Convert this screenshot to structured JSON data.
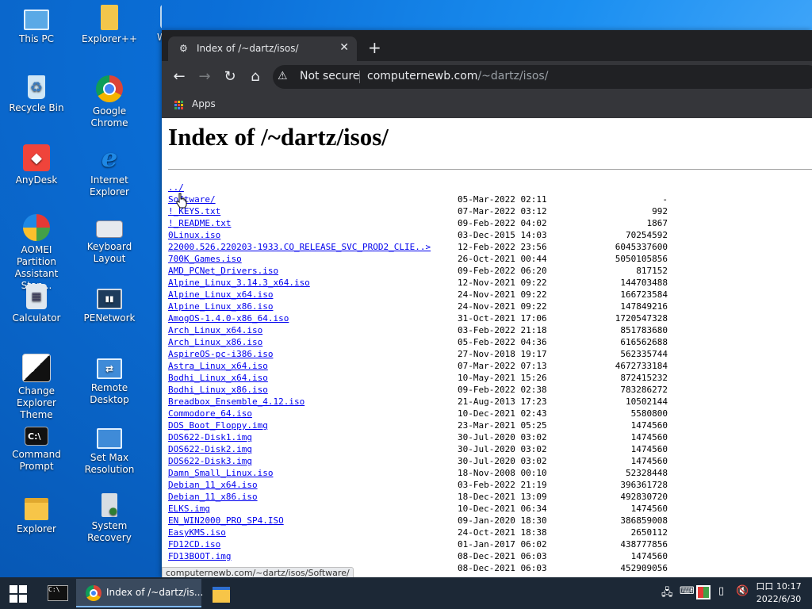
{
  "desktop": {
    "icons": [
      {
        "label": "This PC"
      },
      {
        "label": "Explorer++"
      },
      {
        "label": "W"
      },
      {
        "label": "Recycle Bin"
      },
      {
        "label": "Google Chrome"
      },
      {
        "label": "AnyDesk"
      },
      {
        "label": "Internet Explorer"
      },
      {
        "label": "AOMEI Partition Assistant Stan..."
      },
      {
        "label": "Keyboard Layout"
      },
      {
        "label": "Calculator"
      },
      {
        "label": "PENetwork"
      },
      {
        "label": "Change Explorer Theme"
      },
      {
        "label": "Remote Desktop"
      },
      {
        "label": "Command Prompt"
      },
      {
        "label": "Set Max Resolution"
      },
      {
        "label": "Explorer"
      },
      {
        "label": "System Recovery"
      }
    ]
  },
  "browser": {
    "tab_title": "Index of /~dartz/isos/",
    "new_tab": "+",
    "close_tab": "✕",
    "security_label": "Not secure",
    "url_host": "computernewb.com",
    "url_path": "/~dartz/isos/",
    "bookmarks_apps": "Apps",
    "status_url": "computernewb.com/~dartz/isos/Software/"
  },
  "page": {
    "heading": "Index of /~dartz/isos/",
    "entries": [
      {
        "name": "../",
        "date": "",
        "size": ""
      },
      {
        "name": "Software/",
        "date": "05-Mar-2022 02:11",
        "size": "-"
      },
      {
        "name": "!_KEYS.txt",
        "date": "07-Mar-2022 03:12",
        "size": "992"
      },
      {
        "name": "!_README.txt",
        "date": "09-Feb-2022 04:02",
        "size": "1867"
      },
      {
        "name": "0Linux.iso",
        "date": "03-Dec-2015 14:03",
        "size": "70254592"
      },
      {
        "name": "22000.526.220203-1933.CO_RELEASE_SVC_PROD2_CLIE..>",
        "date": "12-Feb-2022 23:56",
        "size": "6045337600"
      },
      {
        "name": "700K_Games.iso",
        "date": "26-Oct-2021 00:44",
        "size": "5050105856"
      },
      {
        "name": "AMD_PCNet_Drivers.iso",
        "date": "09-Feb-2022 06:20",
        "size": "817152"
      },
      {
        "name": "Alpine_Linux_3.14.3_x64.iso",
        "date": "12-Nov-2021 09:22",
        "size": "144703488"
      },
      {
        "name": "Alpine_Linux_x64.iso",
        "date": "24-Nov-2021 09:22",
        "size": "166723584"
      },
      {
        "name": "Alpine_Linux_x86.iso",
        "date": "24-Nov-2021 09:22",
        "size": "147849216"
      },
      {
        "name": "AmogOS-1.4.0-x86_64.iso",
        "date": "31-Oct-2021 17:06",
        "size": "1720547328"
      },
      {
        "name": "Arch_Linux_x64.iso",
        "date": "03-Feb-2022 21:18",
        "size": "851783680"
      },
      {
        "name": "Arch_Linux_x86.iso",
        "date": "05-Feb-2022 04:36",
        "size": "616562688"
      },
      {
        "name": "AspireOS-pc-i386.iso",
        "date": "27-Nov-2018 19:17",
        "size": "562335744"
      },
      {
        "name": "Astra_Linux_x64.iso",
        "date": "07-Mar-2022 07:13",
        "size": "4672733184"
      },
      {
        "name": "Bodhi_Linux_x64.iso",
        "date": "10-May-2021 15:26",
        "size": "872415232"
      },
      {
        "name": "Bodhi_Linux_x86.iso",
        "date": "09-Feb-2022 02:38",
        "size": "783286272"
      },
      {
        "name": "Breadbox_Ensemble_4.12.iso",
        "date": "21-Aug-2013 17:23",
        "size": "10502144"
      },
      {
        "name": "Commodore_64.iso",
        "date": "10-Dec-2021 02:43",
        "size": "5580800"
      },
      {
        "name": "DOS_Boot_Floppy.img",
        "date": "23-Mar-2021 05:25",
        "size": "1474560"
      },
      {
        "name": "DOS622-Disk1.img",
        "date": "30-Jul-2020 03:02",
        "size": "1474560"
      },
      {
        "name": "DOS622-Disk2.img",
        "date": "30-Jul-2020 03:02",
        "size": "1474560"
      },
      {
        "name": "DOS622-Disk3.img",
        "date": "30-Jul-2020 03:02",
        "size": "1474560"
      },
      {
        "name": "Damn_Small_Linux.iso",
        "date": "18-Nov-2008 00:10",
        "size": "52328448"
      },
      {
        "name": "Debian_11_x64.iso",
        "date": "03-Feb-2022 21:19",
        "size": "396361728"
      },
      {
        "name": "Debian_11_x86.iso",
        "date": "18-Dec-2021 13:09",
        "size": "492830720"
      },
      {
        "name": "ELKS.img",
        "date": "10-Dec-2021 06:34",
        "size": "1474560"
      },
      {
        "name": "EN_WIN2000_PRO_SP4.ISO",
        "date": "09-Jan-2020 18:30",
        "size": "386859008"
      },
      {
        "name": "EasyKMS.iso",
        "date": "24-Oct-2021 18:38",
        "size": "2650112"
      },
      {
        "name": "FD12CD.iso",
        "date": "01-Jan-2017 06:02",
        "size": "438777856"
      },
      {
        "name": "FD13BOOT.img",
        "date": "08-Dec-2021 06:03",
        "size": "1474560"
      },
      {
        "name": "",
        "date": "08-Dec-2021 06:03",
        "size": "452909056"
      }
    ]
  },
  "taskbar": {
    "chrome_label": "Index of /~dartz/is...",
    "clock_time": "口口 10:17",
    "clock_date": "2022/6/30"
  }
}
